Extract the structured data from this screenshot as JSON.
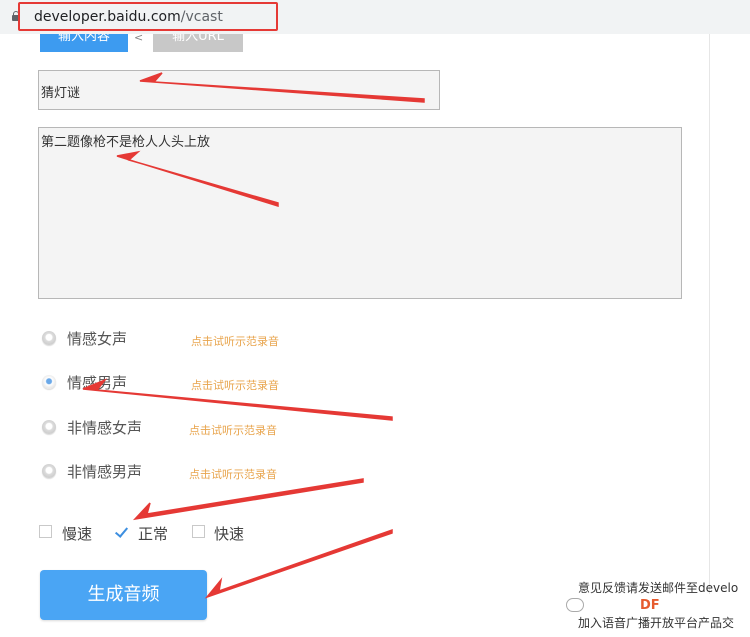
{
  "browser": {
    "url_host": "developer.baidu.com",
    "url_path": "/vcast"
  },
  "tabs": [
    {
      "label": "输入内容"
    },
    {
      "label": "输入URL"
    }
  ],
  "tab_separator": "<",
  "form": {
    "title_value": "猜灯谜",
    "content_value": "第二题像枪不是枪人人头上放"
  },
  "voices": [
    {
      "label": "情感女声",
      "sample_link": "点击试听示范录音",
      "selected": false
    },
    {
      "label": "情感男声",
      "sample_link": "点击试听示范录音",
      "selected": true
    },
    {
      "label": "非情感女声",
      "sample_link": "点击试听示范录音",
      "selected": false
    },
    {
      "label": "非情感男声",
      "sample_link": "点击试听示范录音",
      "selected": false
    }
  ],
  "speeds": [
    {
      "label": "慢速",
      "checked": false
    },
    {
      "label": "正常",
      "checked": true
    },
    {
      "label": "快速",
      "checked": false
    }
  ],
  "generate_button": "生成音频",
  "footer": {
    "feedback_line1": "意见反馈请发送邮件至develo",
    "feedback_line3": "加入语音广播开放平台产品交"
  },
  "watermark": {
    "brand": "DF"
  },
  "colors": {
    "accent": "#4aa5f4",
    "link": "#e8a44c",
    "annotation": "#e53935"
  }
}
